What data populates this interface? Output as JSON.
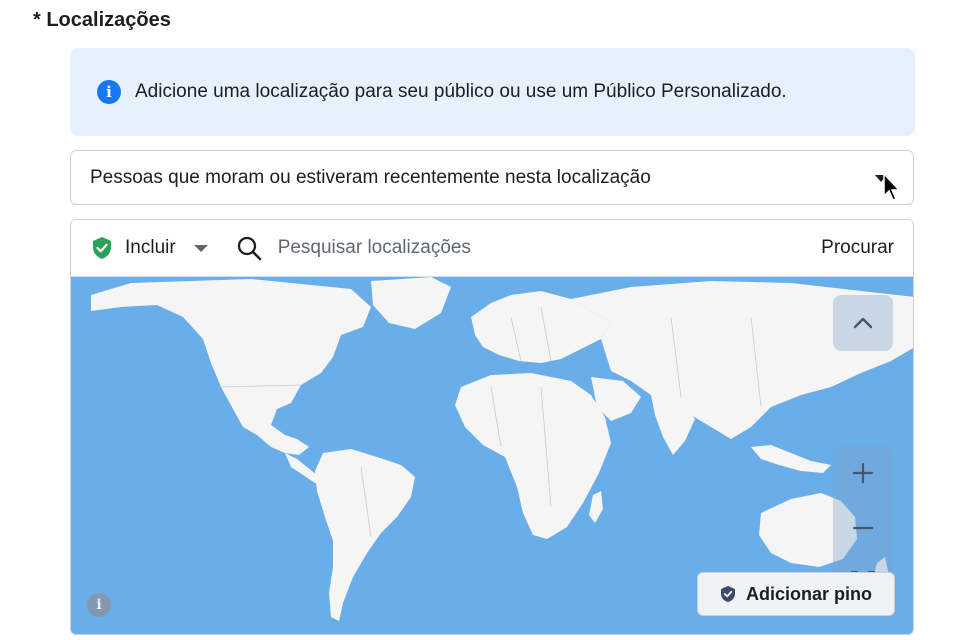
{
  "section": {
    "title": "* Localizações"
  },
  "info_banner": {
    "icon": "info-icon",
    "text": "Adicione uma localização para seu público ou use um Público Personalizado."
  },
  "location_type_select": {
    "value": "Pessoas que moram ou estiveram recentemente nesta localização",
    "icon": "caret-down-icon"
  },
  "map_toolbar": {
    "include_label": "Incluir",
    "include_icon": "shield-check-icon",
    "search_placeholder": "Pesquisar localizações",
    "search_button": "Procurar"
  },
  "map_controls": {
    "collapse_icon": "chevron-up-icon",
    "zoom_in_icon": "plus-icon",
    "zoom_out_icon": "minus-icon",
    "locate_icon": "locate-pin-icon",
    "add_pin_label": "Adicionar pino",
    "map_info_icon": "info-icon"
  },
  "colors": {
    "ocean": "#6aaee9",
    "land": "#f5f5f5",
    "info_bg": "#e7f0fd",
    "accent": "#1877f2",
    "shield_green": "#2ca15b"
  }
}
